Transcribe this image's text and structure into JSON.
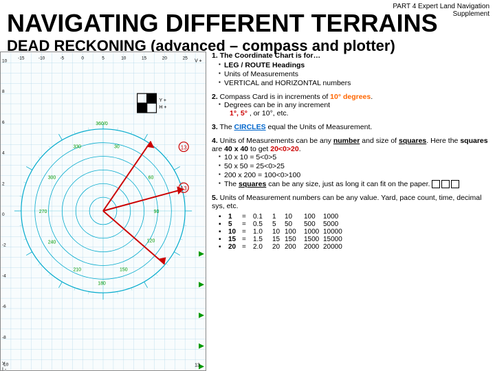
{
  "header": {
    "line1": "PART 4  Expert  Land Navigation",
    "line2": "Supplement"
  },
  "main_title": "NAVIGATING DIFFERENT TERRAINS",
  "sub_title": "DEAD RECKONING (advanced – compass and plotter)",
  "content": {
    "section1": {
      "number": "1.",
      "text": "The Coordinate Chart is for…",
      "bullets": [
        "LEG / ROUTE Headings",
        "Units of Measurements",
        "VERTICAL and HORIZONTAL numbers"
      ]
    },
    "section2": {
      "number": "2.",
      "text_before": "Compass Card is in increments of ",
      "highlight": "10° degrees",
      "text_after": ".",
      "sub_bullet": "Degrees can be in any increment",
      "sub_highlight1": "1°, 5°",
      "sub_highlight2": ", or 10°, etc."
    },
    "section3": {
      "number": "3.",
      "text_before": "The ",
      "highlight": "CIRCLES",
      "text_after": " equal the Units of Measurement."
    },
    "section4": {
      "number": "4.",
      "text_before": "Units of Measurements can be any ",
      "highlight_num": "number",
      "text_mid": " and size of ",
      "highlight_sq": "squares",
      "text_after": ".  Here the squares are 40 x 40 to get ",
      "highlight_20": "20<0>20",
      "bullets": [
        "10 x 10 = 5<0>5",
        "50 x 50 = 25<0>25",
        "200 x 200 = 100<0>100",
        "The squares can be any size, just as long it can fit on the paper."
      ]
    },
    "section5": {
      "number": "5.",
      "text": "Units of Measurement numbers can be any value. Yard, pace count, time, decimal sys, etc.",
      "table": {
        "rows": [
          {
            "label": "1",
            "eq": "=",
            "v1": "0.1",
            "v2": "1",
            "v3": "10",
            "v4": "100",
            "v5": "1000"
          },
          {
            "label": "5",
            "eq": "=",
            "v1": "0.5",
            "v2": "5",
            "v3": "50",
            "v4": "500",
            "v5": "5000"
          },
          {
            "label": "10",
            "eq": "=",
            "v1": "1.0",
            "v2": "10",
            "v3": "100",
            "v4": "1000",
            "v5": "10000"
          },
          {
            "label": "15",
            "eq": "=",
            "v1": "1.5",
            "v2": "15",
            "v3": "150",
            "v4": "1500",
            "v5": "15000"
          },
          {
            "label": "20",
            "eq": "=",
            "v1": "2.0",
            "v2": "20",
            "v3": "200",
            "v4": "2000",
            "v5": "20000"
          }
        ]
      }
    }
  }
}
